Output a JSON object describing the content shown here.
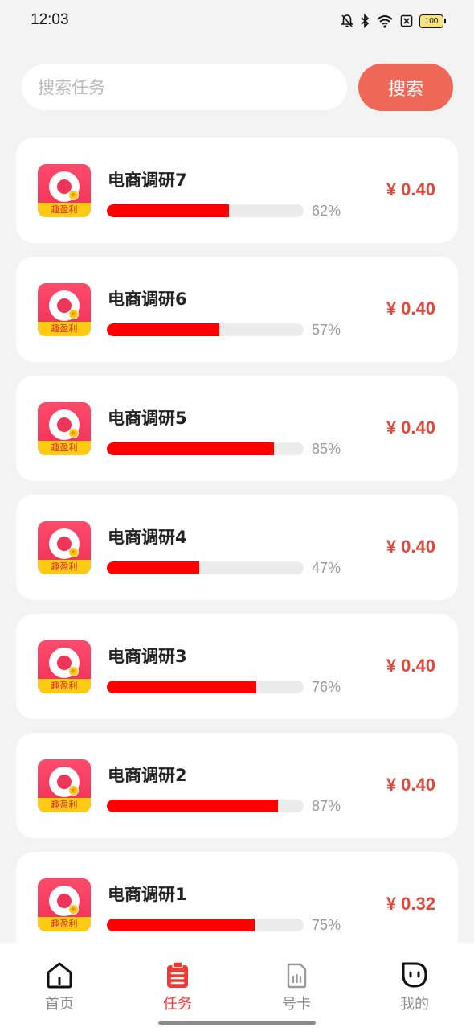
{
  "status_bar": {
    "time": "12:03",
    "battery": "100"
  },
  "search": {
    "placeholder": "搜索任务",
    "button_label": "搜索"
  },
  "app_icon": {
    "label": "趣盈利"
  },
  "tasks": [
    {
      "title": "电商调研7",
      "progress_percent": 62,
      "progress_label": "62%",
      "reward": "¥ 0.40"
    },
    {
      "title": "电商调研6",
      "progress_percent": 57,
      "progress_label": "57%",
      "reward": "¥ 0.40"
    },
    {
      "title": "电商调研5",
      "progress_percent": 85,
      "progress_label": "85%",
      "reward": "¥ 0.40"
    },
    {
      "title": "电商调研4",
      "progress_percent": 47,
      "progress_label": "47%",
      "reward": "¥ 0.40"
    },
    {
      "title": "电商调研3",
      "progress_percent": 76,
      "progress_label": "76%",
      "reward": "¥ 0.40"
    },
    {
      "title": "电商调研2",
      "progress_percent": 87,
      "progress_label": "87%",
      "reward": "¥ 0.40"
    },
    {
      "title": "电商调研1",
      "progress_percent": 75,
      "progress_label": "75%",
      "reward": "¥ 0.32"
    }
  ],
  "bottom_nav": {
    "items": [
      {
        "label": "首页",
        "icon": "home-icon"
      },
      {
        "label": "任务",
        "icon": "clipboard-icon"
      },
      {
        "label": "号卡",
        "icon": "sim-card-icon"
      },
      {
        "label": "我的",
        "icon": "profile-icon"
      }
    ],
    "active_index": 1
  },
  "colors": {
    "accent": "#ef6857",
    "progress_fill": "#ff0000",
    "reward": "#e0483c",
    "nav_active": "#ee3a32"
  }
}
